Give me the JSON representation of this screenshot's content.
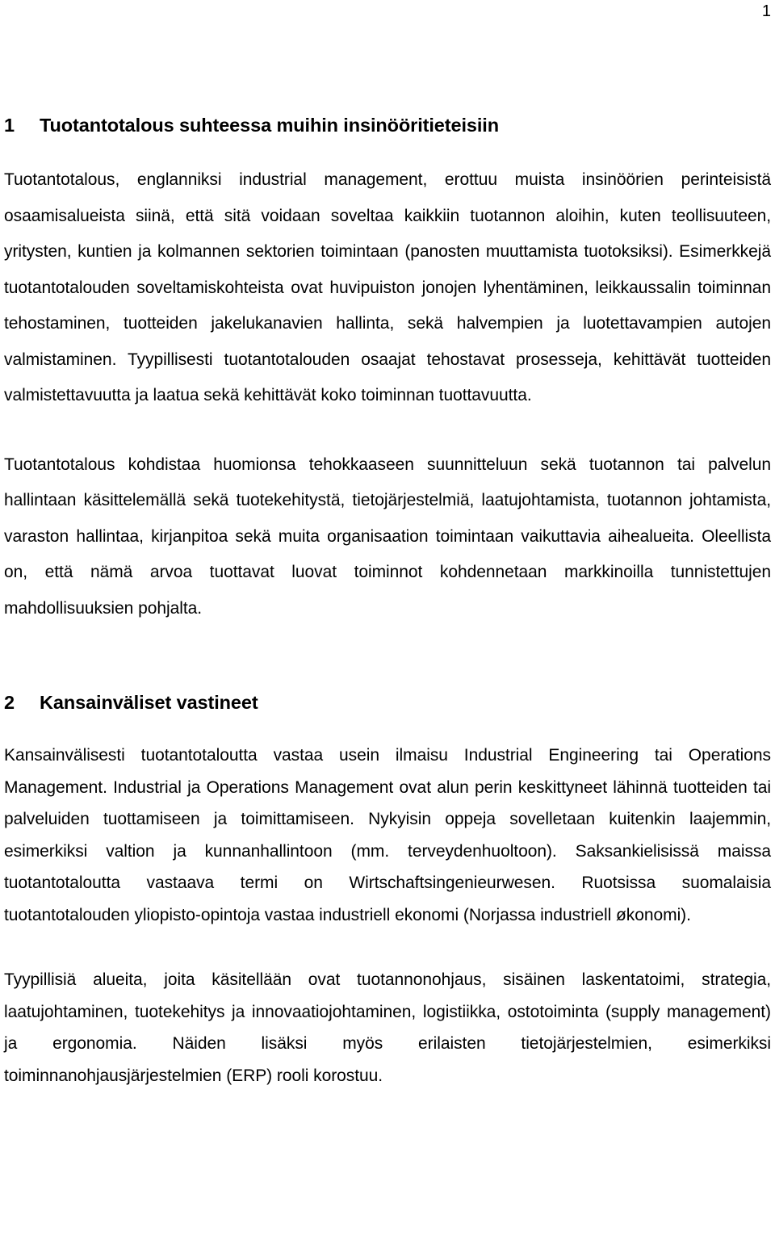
{
  "document": {
    "page_number": "1",
    "language": "fi"
  },
  "sections": [
    {
      "number": "1",
      "title": "Tuotantotalous suhteessa muihin insinööritieteisiin",
      "paragraphs": [
        "Tuotantotalous, englanniksi industrial management, erottuu muista insinöörien perinteisistä osaamisalueista siinä, että sitä voidaan soveltaa kaikkiin tuotannon aloihin, kuten teollisuuteen, yritysten, kuntien ja kolmannen sektorien toimintaan (panosten muuttamista tuotoksiksi). Esimerkkejä tuotantotalouden soveltamiskohteista ovat huvipuiston jonojen lyhentäminen, leikkaussalin toiminnan tehostaminen, tuotteiden jakelukanavien hallinta, sekä halvempien ja luotettavampien autojen valmistaminen. Tyypillisesti tuotantotalouden osaajat tehostavat prosesseja, kehittävät tuotteiden valmistettavuutta ja laatua sekä kehittävät koko toiminnan tuottavuutta.",
        "Tuotantotalous kohdistaa huomionsa tehokkaaseen suunnitteluun sekä tuotannon tai palvelun hallintaan käsittelemällä sekä tuotekehitystä, tietojärjestelmiä, laatujohtamista, tuotannon johtamista, varaston hallintaa, kirjanpitoa sekä muita organisaation toimintaan vaikuttavia aihealueita. Oleellista on, että nämä arvoa tuottavat luovat toiminnot kohdennetaan markkinoilla tunnistettujen mahdollisuuksien pohjalta."
      ]
    },
    {
      "number": "2",
      "title": "Kansainväliset vastineet",
      "paragraphs": [
        "Kansainvälisesti tuotantotaloutta vastaa usein ilmaisu Industrial Engineering tai Operations Management. Industrial ja Operations Management ovat alun perin keskittyneet lähinnä tuotteiden tai palveluiden tuottamiseen ja toimittamiseen. Nykyisin oppeja sovelletaan kuitenkin laajemmin, esimerkiksi valtion ja kunnanhallintoon (mm. terveydenhuoltoon). Saksankielisissä maissa tuotantotaloutta vastaava termi on Wirtschaftsingenieurwesen. Ruotsissa suomalaisia tuotantotalouden yliopisto-opintoja vastaa industriell ekonomi (Norjassa industriell økonomi).",
        "Tyypillisiä alueita, joita käsitellään ovat tuotannonohjaus, sisäinen laskentatoimi, strategia, laatujohtaminen, tuotekehitys ja innovaatiojohtaminen, logistiikka, ostotoiminta (supply management) ja ergonomia. Näiden lisäksi myös erilaisten tietojärjestelmien, esimerkiksi toiminnanohjausjärjestelmien (ERP) rooli korostuu."
      ]
    }
  ]
}
